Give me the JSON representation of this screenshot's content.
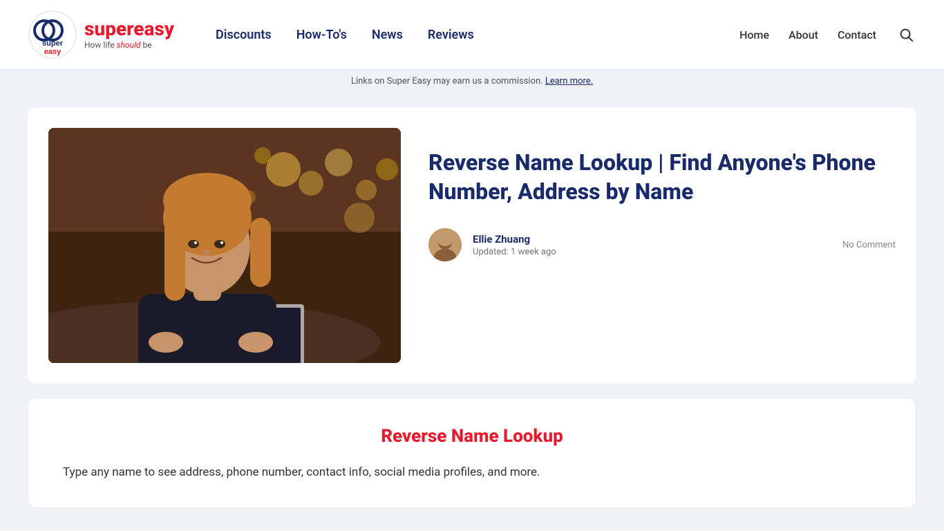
{
  "header": {
    "logo": {
      "brand_super": "super",
      "brand_easy": "easy",
      "tagline_normal": "How life ",
      "tagline_italic": "should",
      "tagline_end": " be"
    },
    "nav": {
      "items": [
        {
          "label": "Discounts",
          "href": "#"
        },
        {
          "label": "How-To's",
          "href": "#"
        },
        {
          "label": "News",
          "href": "#"
        },
        {
          "label": "Reviews",
          "href": "#"
        }
      ]
    },
    "right_nav": {
      "items": [
        {
          "label": "Home",
          "href": "#"
        },
        {
          "label": "About",
          "href": "#"
        },
        {
          "label": "Contact",
          "href": "#"
        }
      ]
    }
  },
  "notice": {
    "text": "Links on Super Easy may earn us a commission. ",
    "link_text": "Learn more."
  },
  "article": {
    "title": "Reverse Name Lookup | Find Anyone's Phone Number, Address by Name",
    "author": {
      "name": "Ellie Zhuang",
      "updated": "Updated: 1 week ago"
    },
    "no_comment": "No Comment"
  },
  "content_box": {
    "title": "Reverse Name Lookup",
    "text": "Type any name to see address, phone number, contact info, social media profiles, and more."
  }
}
